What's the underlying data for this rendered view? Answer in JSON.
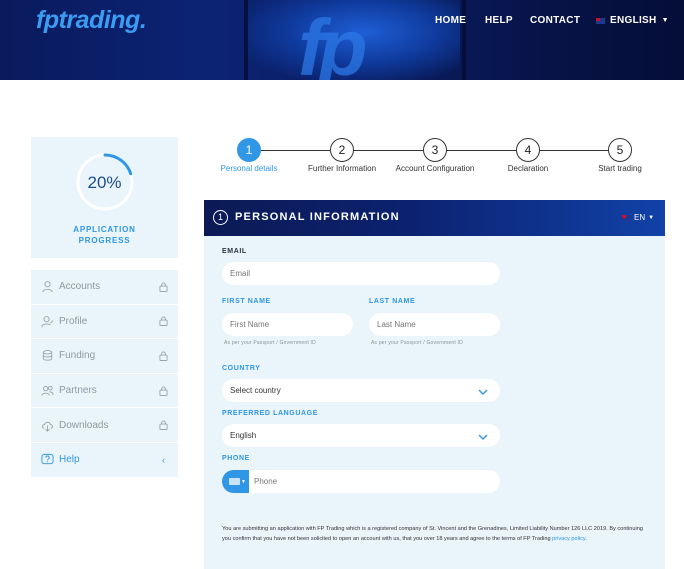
{
  "header": {
    "logo": "fptrading",
    "logo_dot": ".",
    "watermark": "fp",
    "nav": {
      "home": "HOME",
      "help": "HELP",
      "contact": "CONTACT",
      "language": "ENGLISH"
    }
  },
  "sidebar": {
    "progress_value": "20%",
    "progress_fraction": 0.2,
    "progress_label_line1": "APPLICATION",
    "progress_label_line2": "PROGRESS",
    "items": [
      {
        "label": "Accounts",
        "icon": "user-icon",
        "locked": true
      },
      {
        "label": "Profile",
        "icon": "user-edit-icon",
        "locked": true
      },
      {
        "label": "Funding",
        "icon": "coins-icon",
        "locked": true
      },
      {
        "label": "Partners",
        "icon": "users-icon",
        "locked": true
      },
      {
        "label": "Downloads",
        "icon": "cloud-download-icon",
        "locked": true
      }
    ],
    "help_label": "Help",
    "help_chevron": "‹"
  },
  "stepper": {
    "steps": [
      {
        "number": "1",
        "label": "Personal details",
        "active": true
      },
      {
        "number": "2",
        "label": "Further Information",
        "active": false
      },
      {
        "number": "3",
        "label": "Account Configuration",
        "active": false
      },
      {
        "number": "4",
        "label": "Declaration",
        "active": false
      },
      {
        "number": "5",
        "label": "Start trading",
        "active": false
      }
    ]
  },
  "form": {
    "section_number": "1",
    "section_title": "PERSONAL INFORMATION",
    "section_lang": "EN",
    "email_label": "EMAIL",
    "email_placeholder": "Email",
    "first_name_label": "FIRST NAME",
    "first_name_placeholder": "First Name",
    "first_name_hint": "As per your Passport / Government ID",
    "last_name_label": "LAST NAME",
    "last_name_placeholder": "Last Name",
    "last_name_hint": "As per your Passport / Government ID",
    "country_label": "COUNTRY",
    "country_value": "Select country",
    "language_label": "PREFERRED LANGUAGE",
    "language_value": "English",
    "phone_label": "PHONE",
    "phone_placeholder": "Phone",
    "disclaimer": "You are submitting an application with FP Trading which is a registered company of St. Vincent and the Grenadines, Limited Liability Number 126 LLC 2019. By continuing you confirm that you have not been solicited to open an account with us, that you over 18 years and agree to the terms of FP Trading ",
    "disclaimer_link": "privacy policy",
    "disclaimer_end": "."
  },
  "colors": {
    "accent": "#2f97e6",
    "header_navy": "#0a1a5c",
    "panel_bg": "#eaf4fb",
    "menu_text": "#8f99a3"
  }
}
